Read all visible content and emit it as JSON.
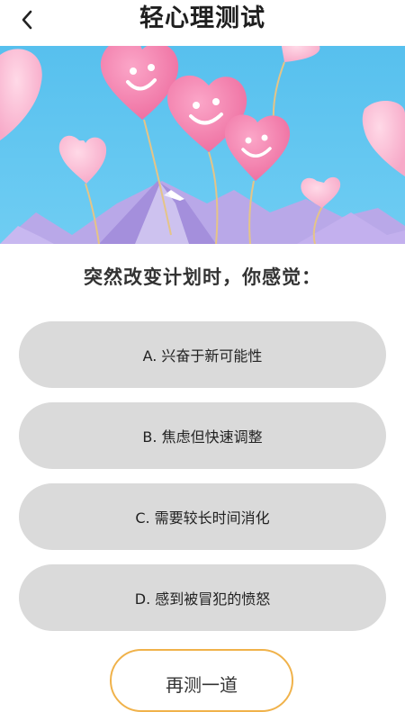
{
  "header": {
    "title": "轻心理测试",
    "back_icon": "chevron-left-icon"
  },
  "banner": {
    "image": "pink-heart-balloons-over-mountains",
    "sky_color": "#5cc3ef",
    "balloon_color": "#f07aa8"
  },
  "quiz": {
    "question": "突然改变计划时，你感觉：",
    "options": [
      {
        "label": "A. 兴奋于新可能性"
      },
      {
        "label": "B. 焦虑但快速调整"
      },
      {
        "label": "C. 需要较长时间消化"
      },
      {
        "label": "D. 感到被冒犯的愤怒"
      }
    ],
    "retry_label": "再测一道"
  },
  "colors": {
    "option_bg": "#dadada",
    "retry_border": "#f0b24a"
  }
}
